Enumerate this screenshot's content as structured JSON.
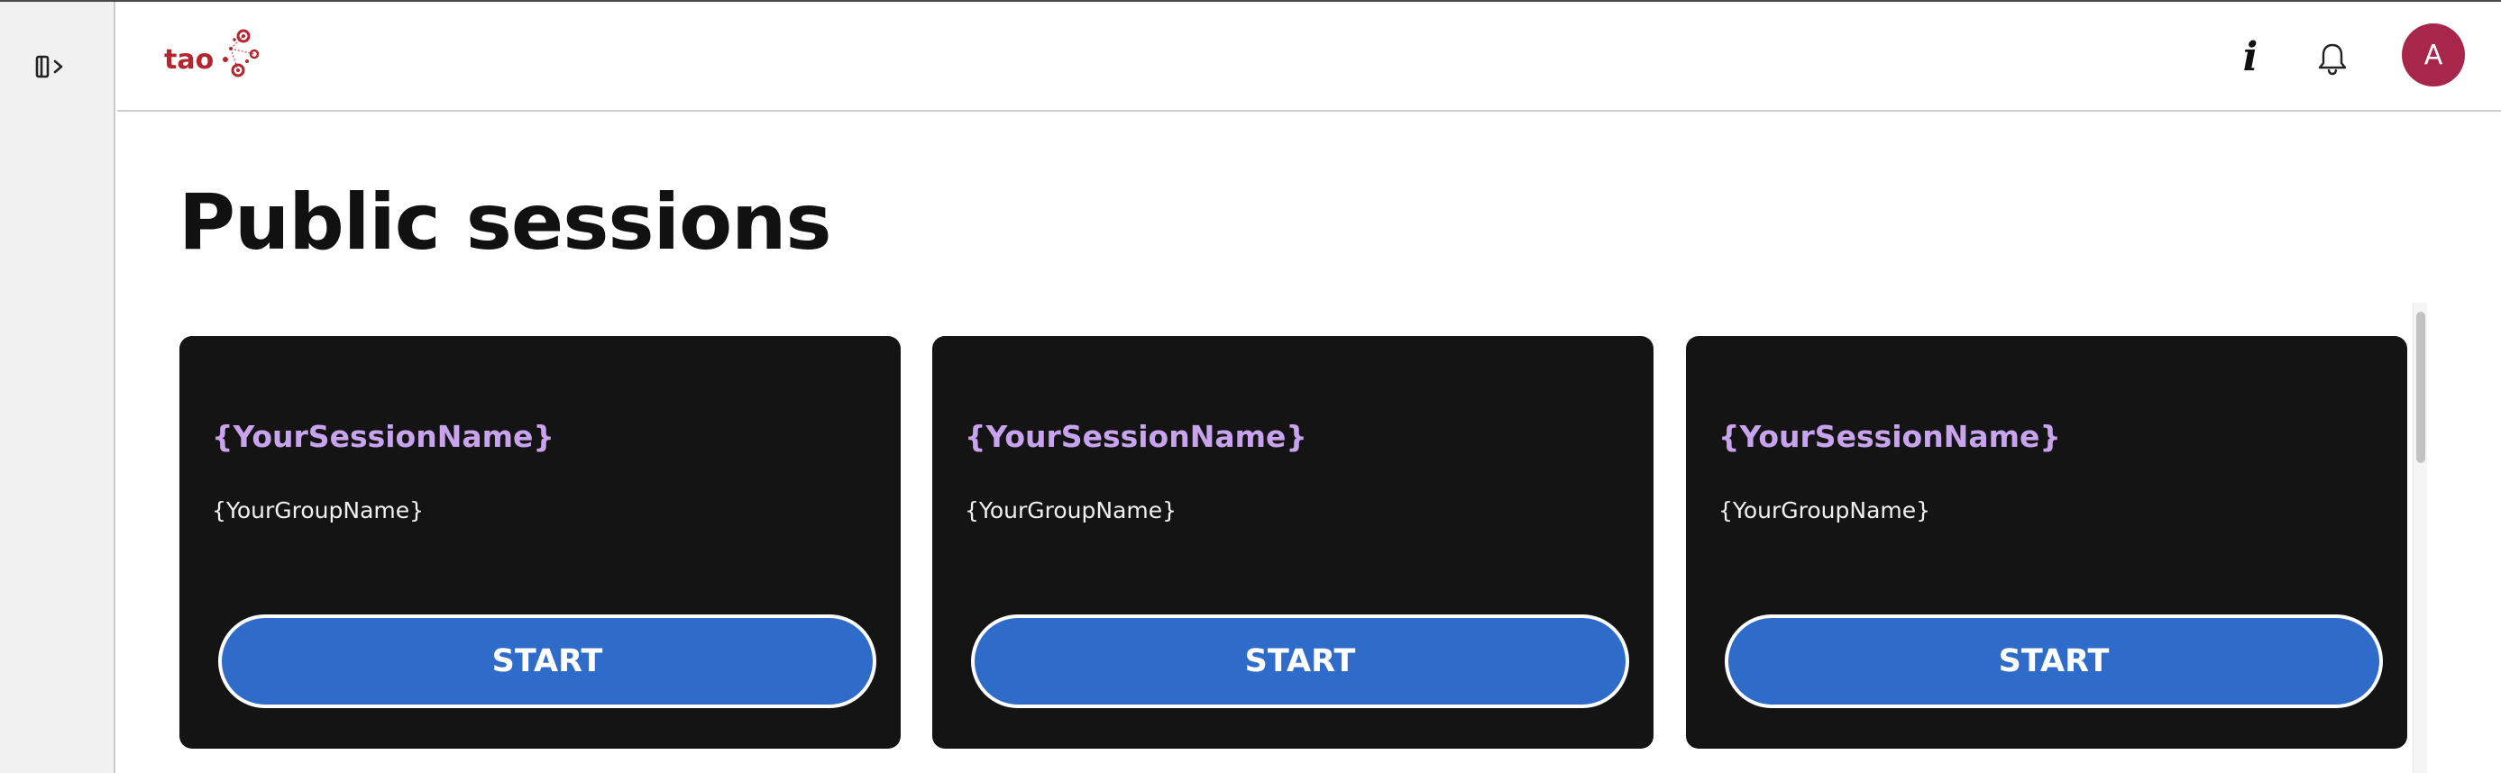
{
  "sidebar": {
    "collapse_icon": "sidebar-expand-icon"
  },
  "header": {
    "logo_text": "tao",
    "info_icon": "info-icon",
    "info_glyph": "i",
    "bell_icon": "bell-icon",
    "avatar_initial": "A",
    "avatar_color": "#a7264a",
    "brand_color": "#b3262f"
  },
  "main": {
    "title": "Public sessions",
    "sessions": [
      {
        "name": "{YourSessionName}",
        "group": "{YourGroupName}",
        "button_label": "START"
      },
      {
        "name": "{YourSessionName}",
        "group": "{YourGroupName}",
        "button_label": "START"
      },
      {
        "name": "{YourSessionName}",
        "group": "{YourGroupName}",
        "button_label": "START"
      }
    ]
  },
  "colors": {
    "card_bg": "#141414",
    "session_name": "#c9a4ee",
    "start_button": "#2f6bc9"
  }
}
